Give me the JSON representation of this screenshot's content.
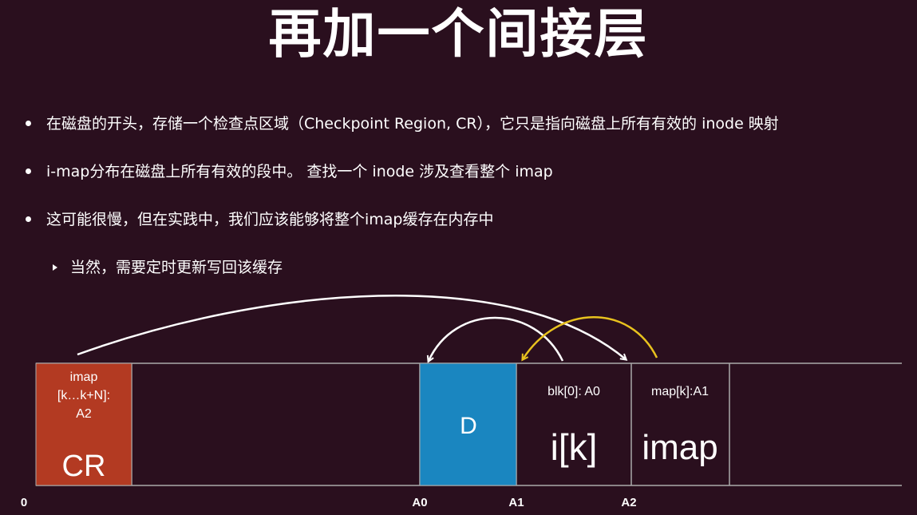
{
  "title": "再加一个间接层",
  "bullets": [
    "在磁盘的开头，存储一个检查点区域（Checkpoint Region, CR），它只是指向磁盘上所有有效的 inode 映射",
    "i-map分布在磁盘上所有有效的段中。 查找一个 inode 涉及查看整个 imap",
    "这可能很慢，但在实践中，我们应该能够将整个imap缓存在内存中"
  ],
  "sub_bullet": "当然，需要定时更新写回该缓存",
  "diagram": {
    "cr_block": {
      "line1": "imap",
      "line2": "[k…k+N]:",
      "line3": "A2",
      "label": "CR",
      "color": "#b33a22"
    },
    "d_block": {
      "label": "D",
      "color": "#1a86c0"
    },
    "inode_block": {
      "caption": "blk[0]: A0",
      "label": "i[k]"
    },
    "imap_block": {
      "caption": "map[k]:A1",
      "label": "imap"
    },
    "addresses": [
      "0",
      "A0",
      "A1",
      "A2"
    ],
    "arrow_colors": {
      "white": "#ffffff",
      "yellow": "#e8c21e"
    }
  }
}
